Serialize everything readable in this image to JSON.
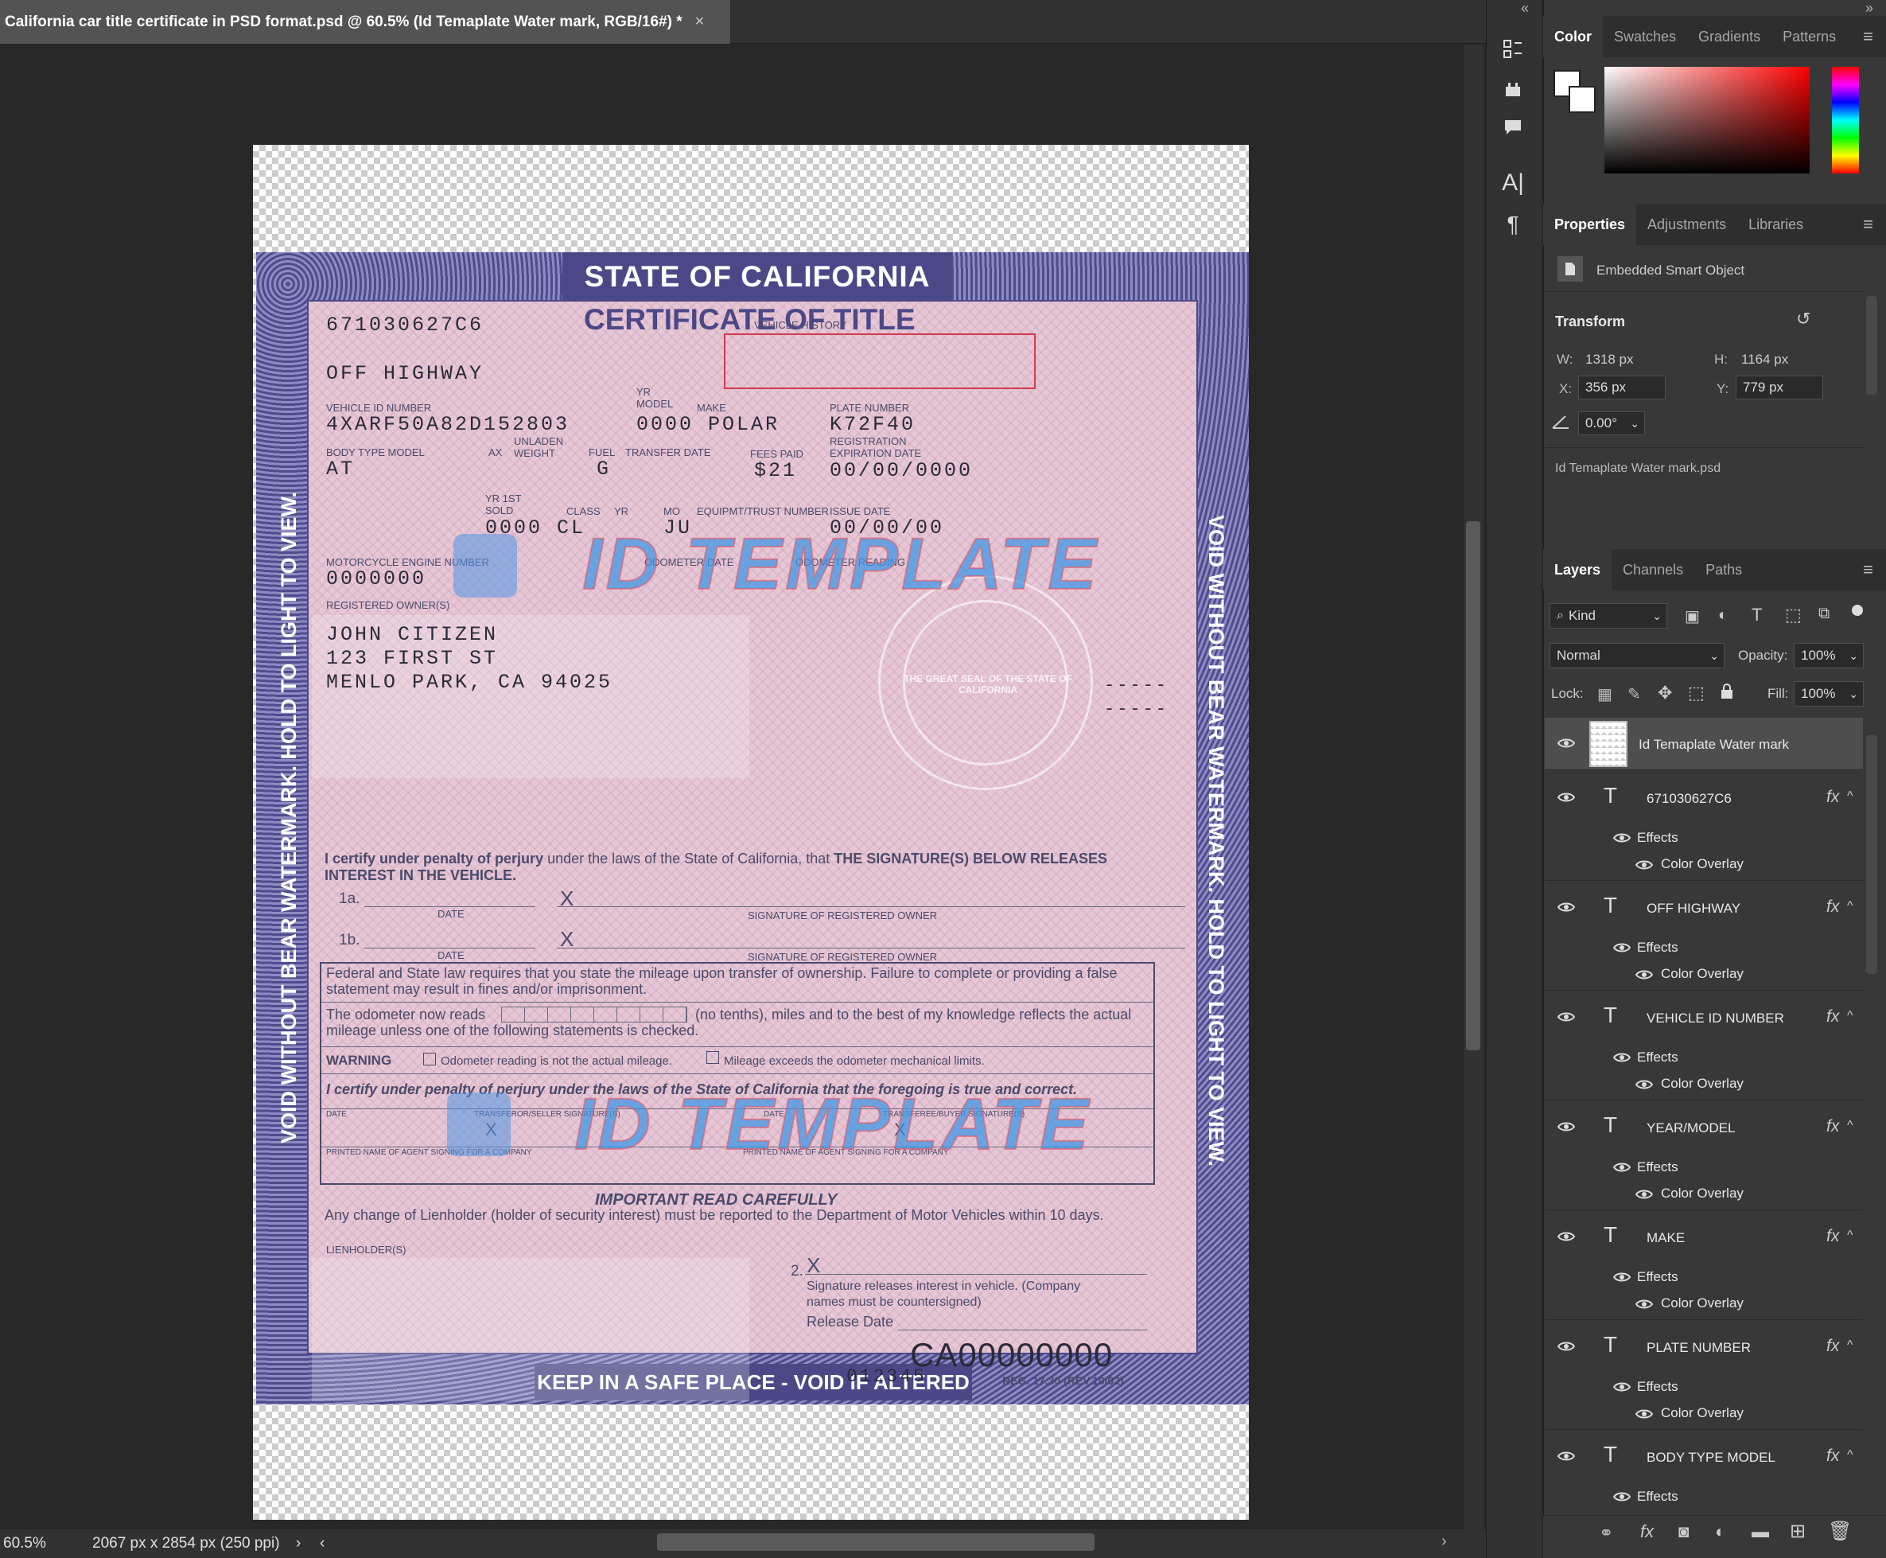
{
  "document": {
    "tab_title": "California car title certificate in PSD format.psd @ 60.5% (Id Temaplate Water mark, RGB/16#) *",
    "close_glyph": "×"
  },
  "status": {
    "zoom": "60.5%",
    "dimensions": "2067 px x 2854 px (250 ppi)",
    "arrow": "›",
    "left_arrow": "‹",
    "right_arrow": "›"
  },
  "certificate": {
    "state": "STATE OF CALIFORNIA",
    "title": "CERTIFICATE OF TITLE",
    "side_text": "VOID WITHOUT BEAR WATERMARK. HOLD TO LIGHT TO VIEW.",
    "bottom_band": "KEEP IN A SAFE PLACE - VOID IF ALTERED",
    "vehicle_history_label": "VEHICLE HISTORY",
    "doc_number": "671030627C6",
    "off_highway": "OFF HIGHWAY",
    "vin_label": "VEHICLE ID NUMBER",
    "vin": "4XARF50A82D152803",
    "yr_model_label": "YR MODEL",
    "make_label": "MAKE",
    "year_make": "0000 POLAR",
    "plate_label": "PLATE NUMBER",
    "plate": "K72F40",
    "body_type_label": "BODY TYPE MODEL",
    "body_type": "AT",
    "ax_label": "AX",
    "unladen_label": "UNLADEN WEIGHT",
    "fuel_label": "FUEL",
    "fuel": "G",
    "transfer_label": "TRANSFER DATE",
    "fees_label": "FEES PAID",
    "fees": "$21",
    "reg_exp_label": "REGISTRATION EXPIRATION DATE",
    "reg_exp": "00/00/0000",
    "yr_sold_label": "YR 1ST SOLD",
    "class_label": "CLASS",
    "yr_label": "YR",
    "mo_label": "MO",
    "equip_label": "EQUIPMT/TRUST NUMBER",
    "issue_label": "ISSUE DATE",
    "sold_class": "0000 CL",
    "mo": "JU",
    "issue_date": "00/00/00",
    "moto_label": "MOTORCYCLE ENGINE NUMBER",
    "moto": "0000000",
    "odometer_date_label": "ODOMETER DATE",
    "odometer_reading_label": "ODOMETER READING",
    "owner_label": "REGISTERED OWNER(S)",
    "owner_name": "JOHN CITIZEN",
    "owner_street": "123 FIRST ST",
    "owner_city": "MENLO PARK, CA 94025",
    "dashes1": "-----",
    "dashes2": "-----",
    "seal_text": "THE GREAT SEAL OF THE STATE OF CALIFORNIA",
    "certify_bold": "I certify under penalty of perjury",
    "certify_mid": " under the laws of the State of California, that ",
    "certify_end": "THE SIGNATURE(S) BELOW RELEASES INTEREST IN THE VEHICLE.",
    "sig_1a": "1a.",
    "sig_1b": "1b.",
    "x_mark": "X",
    "date_label": "DATE",
    "sig_owner_label": "SIGNATURE OF REGISTERED OWNER",
    "federal_text": "Federal and State law requires that you state the mileage upon transfer of ownership. Failure to complete or providing a false statement may result in fines and/or imprisonment.",
    "odometer_text_a": "The odometer now reads",
    "odometer_text_b": "(no tenths), miles and to the best of my knowledge reflects the actual mileage unless one of the following statements is checked.",
    "warning_label": "WARNING",
    "warn_1": "Odometer reading is not the actual mileage.",
    "warn_2": "Mileage exceeds the odometer mechanical limits.",
    "certify2": "I certify under penalty of perjury under the laws of the State of California that the foregoing is true and correct.",
    "transferor_label": "TRANSFEROR/SELLER SIGNATURE(S)",
    "transferee_label": "TRANSFEREE/BUYER SIGNATURE(S)",
    "printed_name_label": "PRINTED NAME OF AGENT SIGNING FOR A COMPANY",
    "important": "IMPORTANT READ CAREFULLY",
    "lien_text": "Any change of Lienholder (holder of security interest) must be reported to the Department of Motor Vehicles within 10 days.",
    "lienholder_label": "LIENHOLDER(S)",
    "sig_2": "2.",
    "release_text": "Signature releases interest in vehicle. (Company names must be countersigned)",
    "release_date": "Release Date",
    "control_no": "012345",
    "ca_number": "CA00000000",
    "reg_form": "REG. 17.30 (REV.10/02)",
    "watermark": "ID TEMPLATE"
  },
  "panels": {
    "color_tabs": [
      "Color",
      "Swatches",
      "Gradients",
      "Patterns"
    ],
    "properties_tabs": [
      "Properties",
      "Adjustments",
      "Libraries"
    ],
    "object_type": "Embedded Smart Object",
    "transform_label": "Transform",
    "w_label": "W:",
    "w_value": "1318 px",
    "h_label": "H:",
    "h_value": "1164 px",
    "x_label": "X:",
    "x_value": "356 px",
    "y_label": "Y:",
    "y_value": "779 px",
    "angle_value": "0.00°",
    "linked_file": "Id Temaplate Water mark.psd",
    "layers_tabs": [
      "Layers",
      "Channels",
      "Paths"
    ],
    "kind_label": "Kind",
    "blend_mode": "Normal",
    "opacity_label": "Opacity:",
    "opacity_value": "100%",
    "lock_label": "Lock:",
    "fill_label": "Fill:",
    "fill_value": "100%",
    "collapse_arrows": "«",
    "expand_arrows": "»"
  },
  "layers": [
    {
      "name": "Id Temaplate Water mark",
      "type": "smart",
      "selected": true
    },
    {
      "name": "671030627C6",
      "type": "text"
    },
    {
      "name": "OFF HIGHWAY",
      "type": "text"
    },
    {
      "name": "VEHICLE ID NUMBER",
      "type": "text"
    },
    {
      "name": "YEAR/MODEL",
      "type": "text"
    },
    {
      "name": "MAKE",
      "type": "text"
    },
    {
      "name": "PLATE NUMBER",
      "type": "text"
    },
    {
      "name": "BODY TYPE MODEL",
      "type": "text"
    }
  ],
  "layer_effects_label": "Effects",
  "layer_effect_name": "Color Overlay",
  "icons": {
    "eye": "eye-icon",
    "text_layer": "T",
    "fx": "fx"
  }
}
